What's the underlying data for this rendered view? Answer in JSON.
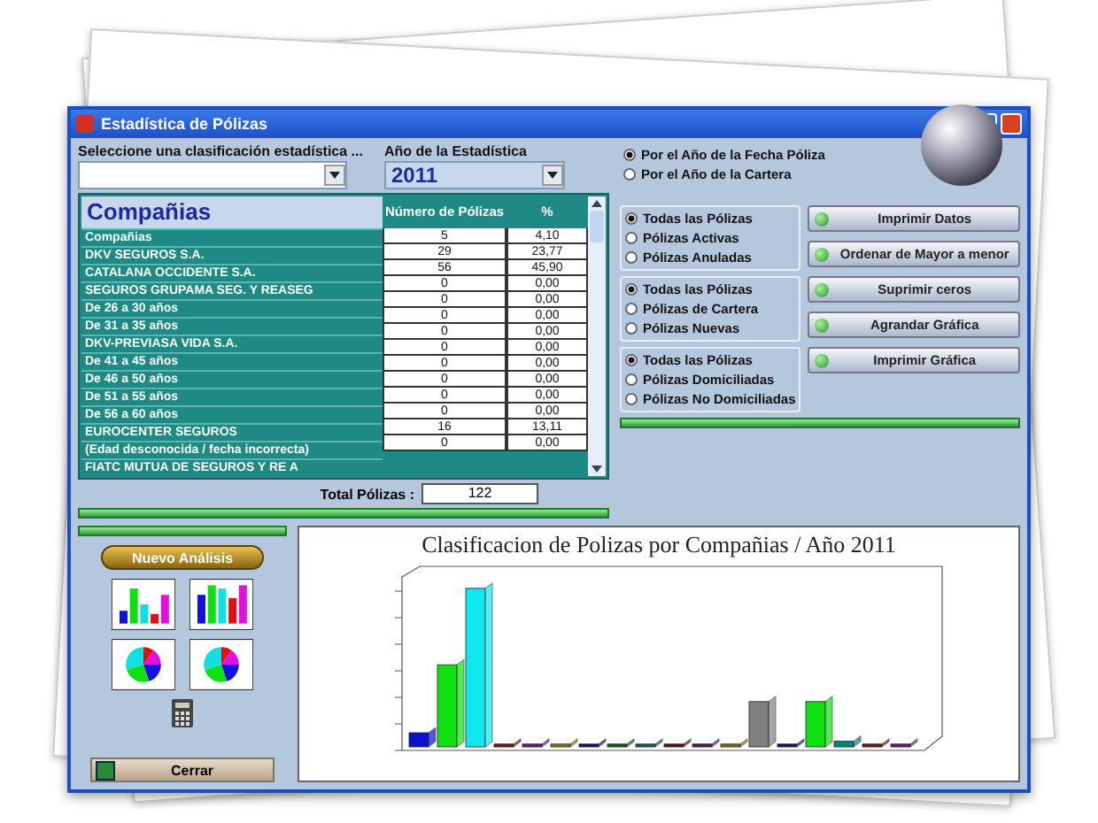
{
  "window": {
    "title": "Estadística de Pólizas"
  },
  "classification": {
    "label": "Seleccione una clasificación estadística ...",
    "heading": "Compañias"
  },
  "year": {
    "label": "Año de la Estadística",
    "value": "2011"
  },
  "table": {
    "names": [
      "Compañias",
      "DKV SEGUROS S.A.",
      "CATALANA OCCIDENTE S.A.",
      "SEGUROS GRUPAMA SEG. Y REASEG",
      "De 26 a 30 años",
      "De 31 a 35 años",
      "DKV-PREVIASA VIDA S.A.",
      "De 41 a 45 años",
      "De 46 a 50 años",
      "De 51 a 55 años",
      "De 56 a 60 años",
      "EUROCENTER SEGUROS",
      "(Edad desconocida / fecha incorrecta)",
      "FIATC MUTUA DE SEGUROS Y RE A"
    ],
    "counts": {
      "header": "Número de Pólizas",
      "values": [
        "5",
        "29",
        "56",
        "0",
        "0",
        "0",
        "0",
        "0",
        "0",
        "0",
        "0",
        "0",
        "16",
        "0"
      ]
    },
    "percentages": {
      "header": "%",
      "values": [
        "4,10",
        "23,77",
        "45,90",
        "0,00",
        "0,00",
        "0,00",
        "0,00",
        "0,00",
        "0,00",
        "0,00",
        "0,00",
        "0,00",
        "13,11",
        "0,00"
      ]
    }
  },
  "total": {
    "label": "Total Pólizas :",
    "value": "122"
  },
  "date_basis": [
    {
      "label": "Por el Año de la Fecha Póliza",
      "selected": true
    },
    {
      "label": "Por el Año de la Cartera",
      "selected": false
    }
  ],
  "filter_groups": [
    {
      "options": [
        {
          "label": "Todas las Pólizas",
          "selected": true
        },
        {
          "label": "Pólizas Activas",
          "selected": false
        },
        {
          "label": "Pólizas Anuladas",
          "selected": false
        }
      ]
    },
    {
      "options": [
        {
          "label": "Todas las Pólizas",
          "selected": true
        },
        {
          "label": "Pólizas de Cartera",
          "selected": false
        },
        {
          "label": "Pólizas Nuevas",
          "selected": false
        }
      ]
    },
    {
      "options": [
        {
          "label": "Todas las Pólizas",
          "selected": true
        },
        {
          "label": "Pólizas Domiciliadas",
          "selected": false
        },
        {
          "label": "Pólizas No Domiciliadas",
          "selected": false
        }
      ]
    }
  ],
  "action_buttons": [
    "Imprimir Datos",
    "Ordenar de Mayor a menor",
    "Suprimir ceros",
    "Agrandar Gráfica",
    "Imprimir Gráfica"
  ],
  "new_analysis_button": "Nuevo Análisis",
  "close_button": "Cerrar",
  "chart": {
    "title": "Clasificacion de Polizas por Compañias / Año 2011"
  }
}
